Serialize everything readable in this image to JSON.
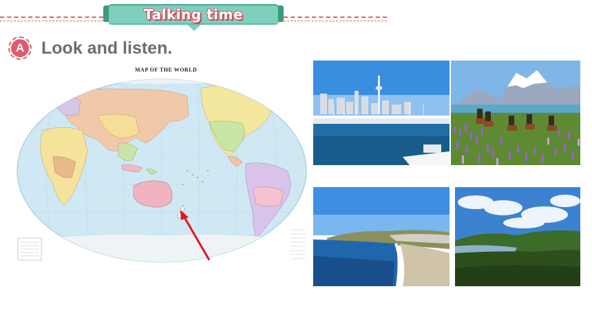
{
  "header": {
    "banner_title": "Talking time",
    "colors": {
      "banner": "#7fcfbd",
      "banner_dark": "#3a9b7f",
      "title_outline": "#e25a6e",
      "dash": "#e55b60"
    }
  },
  "section": {
    "badge_letter": "A",
    "title": "Look and listen."
  },
  "map": {
    "caption": "MAP OF THE WORLD",
    "arrow_color": "#e8141c",
    "arrow_target": "New Zealand"
  },
  "photos": [
    {
      "name": "auckland-harbour-photo"
    },
    {
      "name": "lupin-field-horse-riders-photo"
    },
    {
      "name": "coastal-beach-photo"
    },
    {
      "name": "forest-hills-lake-photo"
    }
  ]
}
